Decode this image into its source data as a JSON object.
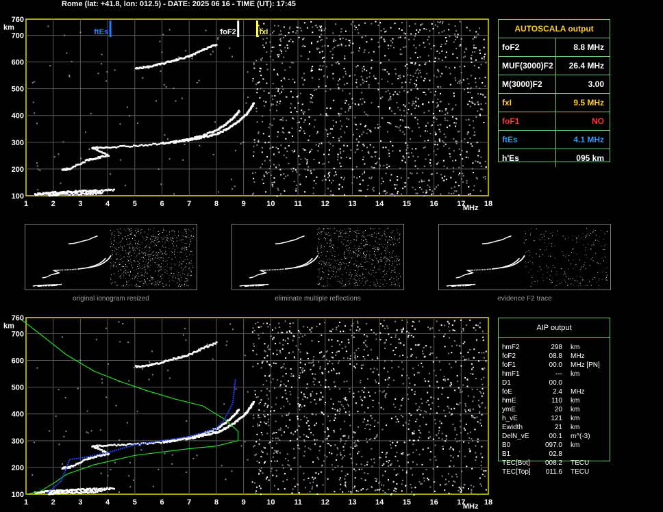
{
  "header": "Rome (lat: +41.8, lon: 012.5) - DATE: 2025 06 16 - TIME (UT): 17:45",
  "ionogram": {
    "x_ticks": [
      "1",
      "2",
      "3",
      "4",
      "5",
      "6",
      "7",
      "8",
      "9",
      "10",
      "11",
      "12",
      "13",
      "14",
      "15",
      "16",
      "17",
      "18"
    ],
    "y_ticks": [
      "100",
      "200",
      "300",
      "400",
      "500",
      "600",
      "700",
      "760"
    ],
    "x_unit": "MHz",
    "y_unit": "km",
    "markers": {
      "ftEs": "ftEs",
      "foF2": "foF2",
      "fxI": "fxI"
    }
  },
  "chart_data": {
    "type": "scatter",
    "xlim": [
      1,
      18
    ],
    "ylim": [
      100,
      760
    ],
    "xlabel": "MHz",
    "ylabel": "km",
    "series": [
      {
        "name": "",
        "points": [
          [
            1.3,
            108
          ],
          [
            1.6,
            112
          ],
          [
            2,
            115
          ],
          [
            2.5,
            118
          ],
          [
            3,
            120
          ],
          [
            3.5,
            122
          ],
          [
            4.2,
            125
          ],
          [
            1.8,
            105
          ],
          [
            2.2,
            108
          ],
          [
            3.2,
            110
          ],
          [
            3.8,
            115
          ]
        ]
      },
      {
        "name": "",
        "points": [
          [
            2.3,
            200
          ],
          [
            2.6,
            205
          ],
          [
            3.2,
            235
          ],
          [
            3.6,
            245
          ],
          [
            4,
            255
          ],
          [
            3.4,
            282
          ],
          [
            4,
            285
          ],
          [
            5,
            290
          ],
          [
            6,
            298
          ],
          [
            6.5,
            305
          ],
          [
            7,
            315
          ],
          [
            7.5,
            330
          ],
          [
            8,
            350
          ],
          [
            8.3,
            370
          ],
          [
            8.6,
            395
          ],
          [
            8.8,
            420
          ]
        ]
      },
      {
        "name": "",
        "points": [
          [
            6,
            300
          ],
          [
            7,
            312
          ],
          [
            7.5,
            322
          ],
          [
            8,
            335
          ],
          [
            8.4,
            355
          ],
          [
            8.7,
            375
          ],
          [
            9.0,
            400
          ],
          [
            9.2,
            425
          ],
          [
            9.35,
            450
          ]
        ]
      },
      {
        "name": "",
        "points": [
          [
            5,
            580
          ],
          [
            5.5,
            585
          ],
          [
            6,
            597
          ],
          [
            6.5,
            612
          ],
          [
            7,
            625
          ],
          [
            7.5,
            650
          ],
          [
            8,
            670
          ]
        ]
      }
    ],
    "markers": [
      {
        "name": "ftEs",
        "x": 4.1,
        "color": "#1e7cff"
      },
      {
        "name": "foF2",
        "x": 8.8,
        "color": "#ffffff"
      },
      {
        "name": "fxI",
        "x": 9.5,
        "color": "#ffff33"
      }
    ],
    "profile_green": [
      [
        0.8,
        755
      ],
      [
        1.5,
        700
      ],
      [
        2.5,
        620
      ],
      [
        3.5,
        560
      ],
      [
        4.5,
        520
      ],
      [
        5.5,
        485
      ],
      [
        6.5,
        455
      ],
      [
        7.5,
        430
      ],
      [
        8.3,
        380
      ],
      [
        8.8,
        335
      ],
      [
        8.8,
        300
      ],
      [
        8,
        280
      ],
      [
        7,
        270
      ],
      [
        5,
        245
      ],
      [
        3.5,
        210
      ],
      [
        2.5,
        175
      ],
      [
        2,
        140
      ],
      [
        1.5,
        110
      ],
      [
        1,
        100
      ]
    ],
    "profile_blue": [
      [
        1.8,
        105
      ],
      [
        2.3,
        150
      ],
      [
        2.6,
        230
      ],
      [
        3,
        235
      ],
      [
        4,
        255
      ],
      [
        5,
        285
      ],
      [
        6,
        300
      ],
      [
        7,
        315
      ],
      [
        8,
        345
      ],
      [
        8.3,
        380
      ],
      [
        8.6,
        440
      ],
      [
        8.7,
        530
      ]
    ]
  },
  "thumbnails": [
    {
      "caption": "original ionogram resized"
    },
    {
      "caption": "eliminate multiple reflections"
    },
    {
      "caption": "evidence F2 trace"
    }
  ],
  "autoscala": {
    "title": "AUTOSCALA output",
    "rows": [
      {
        "label": "foF2",
        "value": "8.8 MHz",
        "label_color": "#ffffff",
        "value_color": "#ffffff"
      },
      {
        "label": "MUF(3000)F2",
        "value": "26.4 MHz",
        "label_color": "#ffffff",
        "value_color": "#ffffff"
      },
      {
        "label": "M(3000)F2",
        "value": "3.00",
        "label_color": "#ffffff",
        "value_color": "#ffffff"
      },
      {
        "label": "fxI",
        "value": "9.5 MHz",
        "label_color": "#ffcc33",
        "value_color": "#ffcc33"
      },
      {
        "label": "foF1",
        "value": "NO",
        "label_color": "#ff3333",
        "value_color": "#ff3333"
      },
      {
        "label": "ftEs",
        "value": "4.1 MHz",
        "label_color": "#3399ff",
        "value_color": "#3399ff"
      },
      {
        "label": "h'Es",
        "value": "095 km",
        "label_color": "#ffffff",
        "value_color": "#ffffff"
      }
    ]
  },
  "aip": {
    "title": "AIP output",
    "rows": [
      {
        "k": "hmF2",
        "v": "298",
        "u": "km"
      },
      {
        "k": "foF2",
        "v": "08.8",
        "u": "MHz"
      },
      {
        "k": "foF1",
        "v": "00.0",
        "u": "MHz   [PN]"
      },
      {
        "k": "hmF1",
        "v": "---",
        "u": "km"
      },
      {
        "k": "D1",
        "v": "00.0",
        "u": ""
      },
      {
        "k": "foE",
        "v": "2.4",
        "u": "MHz"
      },
      {
        "k": "hmE",
        "v": "110",
        "u": "km"
      },
      {
        "k": "ymE",
        "v": "20",
        "u": "km"
      },
      {
        "k": "h_vE",
        "v": "121",
        "u": "km"
      },
      {
        "k": "Ewidth",
        "v": "21",
        "u": "km"
      },
      {
        "k": "DelN_vE",
        "v": "00.1",
        "u": "m^(-3)"
      },
      {
        "k": "B0",
        "v": "097.0",
        "u": "km"
      },
      {
        "k": "B1",
        "v": "02.8",
        "u": ""
      },
      {
        "k": "TEC[Bot]",
        "v": "008.2",
        "u": "TECU"
      },
      {
        "k": "TEC[Top]",
        "v": "011.6",
        "u": "TECU"
      }
    ]
  }
}
